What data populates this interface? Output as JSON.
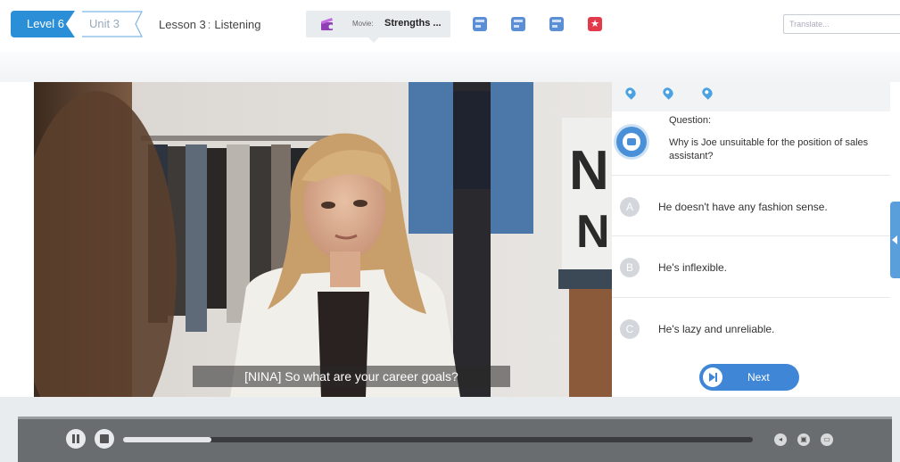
{
  "header": {
    "level_label": "Level 6",
    "unit_label": "Unit 3",
    "lesson_label": "Lesson 3",
    "lesson_sep": ":",
    "lesson_name": "Listening",
    "movie_label": "Movie:",
    "movie_title": "Strengths ...",
    "translate_placeholder": "Translate..."
  },
  "video": {
    "subtitle": "[NINA] So what are your career goals?"
  },
  "question": {
    "label": "Question:",
    "text": "Why is Joe unsuitable for the position of sales assistant?",
    "options": [
      {
        "letter": "A",
        "text": "He doesn't have any fashion sense."
      },
      {
        "letter": "B",
        "text": "He's inflexible."
      },
      {
        "letter": "C",
        "text": "He's lazy and unreliable."
      }
    ],
    "next_label": "Next"
  },
  "player": {
    "progress": 0.14,
    "volume_icon": "speaker-icon",
    "caption_icon": "cc-icon"
  },
  "colors": {
    "accent": "#2b8fd8",
    "next_button": "#3f86d6",
    "player_bar": "#6a6d70"
  }
}
